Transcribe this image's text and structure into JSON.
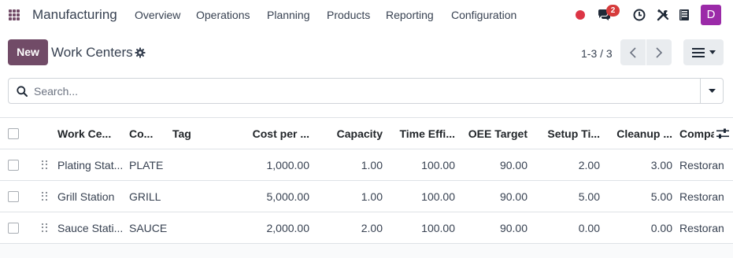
{
  "navbar": {
    "brand": "Manufacturing",
    "menu": [
      "Overview",
      "Operations",
      "Planning",
      "Products",
      "Reporting",
      "Configuration"
    ],
    "message_count": "2",
    "avatar_letter": "D",
    "accent_color": "#714B67",
    "avatar_color": "#9b2aa8"
  },
  "control": {
    "new_label": "New",
    "title": "Work Centers",
    "pager": "1-3 / 3"
  },
  "search": {
    "placeholder": "Search..."
  },
  "table": {
    "headers": [
      "Work Ce...",
      "Co...",
      "Tag",
      "Cost per ...",
      "Capacity",
      "Time Effi...",
      "OEE Target",
      "Setup Ti...",
      "Cleanup ...",
      "Compa"
    ],
    "rows": [
      [
        "Plating Stat...",
        "PLATE",
        "",
        "1,000.00",
        "1.00",
        "100.00",
        "90.00",
        "2.00",
        "3.00",
        "Restoran"
      ],
      [
        "Grill Station",
        "GRILL",
        "",
        "5,000.00",
        "1.00",
        "100.00",
        "90.00",
        "5.00",
        "5.00",
        "Restoran"
      ],
      [
        "Sauce Stati...",
        "SAUCE",
        "",
        "2,000.00",
        "2.00",
        "100.00",
        "90.00",
        "0.00",
        "0.00",
        "Restoran"
      ]
    ]
  }
}
